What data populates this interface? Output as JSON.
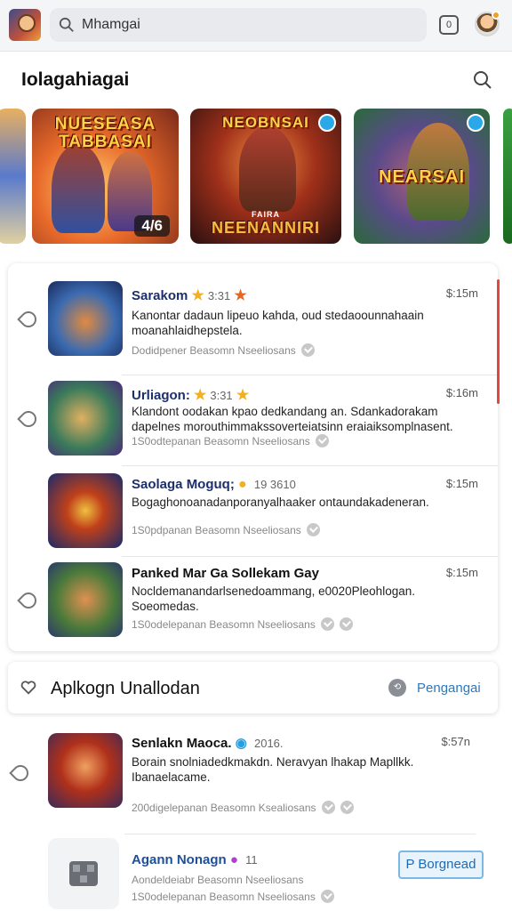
{
  "search": {
    "query": "Mhamgai"
  },
  "header": {
    "square_btn": "0"
  },
  "section": {
    "title": "Iolagahiagai"
  },
  "carousel": [
    {
      "title_top": "NUESEASA TABBASAI",
      "badge": "4/6"
    },
    {
      "title_top": "NEOBNSAI",
      "title_bottom": "NEENANNIRI",
      "small": "FAIRA"
    },
    {
      "title": "NEARSAI"
    }
  ],
  "apps": [
    {
      "name": "Sarakom",
      "rating": "3:31",
      "size": "$:15m",
      "desc": "Kanontar dadaun lipeuo kahda, oud stedaoounnahaain moanahlaidhepstela.",
      "meta": "Dodidpener Beasomn Nseeliosans"
    },
    {
      "name": "Urliagon:",
      "rating": "3:31",
      "size": "$:16m",
      "desc": "Klandont oodakan kpao dedkandang an. Sdankadorakam dapelnes morouthimmakssoverteiatsinn eraiaiksomplnasent.",
      "meta": "1S0odtepanan Beasomn Nseeliosans"
    },
    {
      "name": "Saolaga Moguq;",
      "rating": "19 3610",
      "size": "$:15m",
      "desc": "Bogaghonoanadanporanyalhaaker ontaundakadeneran.",
      "meta": "1S0pdpanan Beasomn Nseeliosans"
    },
    {
      "name": "Panked Mar Ga Sollekam Gay",
      "rating": "",
      "size": "$:15m",
      "desc": "Nocldemanandarlsenedoammang, e0020Pleohlogan. Soeomedas.",
      "meta": "1S0odelepanan Beasomn Nseeliosans"
    }
  ],
  "banner": {
    "label": "Aplkogn Unallodan",
    "action": "Pengangai"
  },
  "bottom_apps": [
    {
      "name": "Senlakn Maoca.",
      "rating": "2016.",
      "size": "$:57n",
      "desc": "Borain snolniadedkmakdn. Neravyan lhakap Mapllkk. Ibanaelacame.",
      "meta": "200digelepanan Beasomn Ksealiosans"
    },
    {
      "name": "Agann Nonagn",
      "rating": "11",
      "desc": "Aondeldeiabr Beasomn Nseeliosans",
      "meta": "1S0odelepanan Beasomn Nseeliosans",
      "button": "P Borgnead"
    }
  ],
  "colors": {
    "accent": "#2a78c2",
    "app_name": "#1d2f6b",
    "star": "#f0b020",
    "scroll": "#e0493b"
  }
}
